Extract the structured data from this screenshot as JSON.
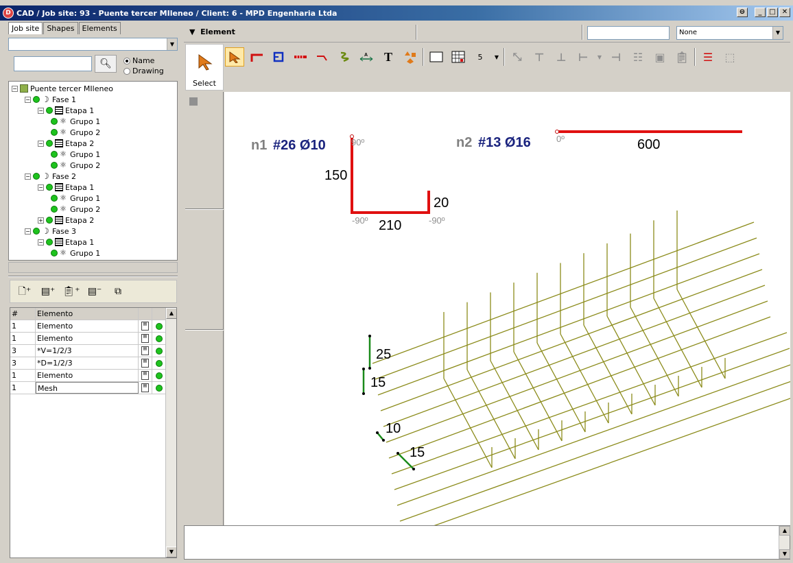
{
  "window": {
    "app_badge": "D",
    "title": "CAD / Job site: 93 - Puente tercer MIleneo  / Client: 6 - MPD Engenharia Ltda"
  },
  "left_panel": {
    "tabs": [
      "Job site",
      "Shapes",
      "Elements"
    ],
    "search": {
      "value": "",
      "radio_name": "Name",
      "radio_drawing": "Drawing"
    },
    "tree": [
      {
        "label": "Puente tercer MIleneo",
        "level": 0
      },
      {
        "label": "Fase 1",
        "level": 1
      },
      {
        "label": "Etapa 1",
        "level": 2
      },
      {
        "label": "Grupo 1",
        "level": 3
      },
      {
        "label": "Grupo 2",
        "level": 3
      },
      {
        "label": "Etapa 2",
        "level": 2
      },
      {
        "label": "Grupo 1",
        "level": 3
      },
      {
        "label": "Grupo 2",
        "level": 3
      },
      {
        "label": "Fase 2",
        "level": 1
      },
      {
        "label": "Etapa 1",
        "level": 2
      },
      {
        "label": "Grupo 1",
        "level": 3
      },
      {
        "label": "Grupo 2",
        "level": 3
      },
      {
        "label": "Etapa 2",
        "level": 2
      },
      {
        "label": "Fase 3",
        "level": 1
      },
      {
        "label": "Etapa 1",
        "level": 2
      },
      {
        "label": "Grupo 1",
        "level": 3
      }
    ],
    "grid": {
      "headers": [
        "#",
        "Elemento"
      ],
      "rows": [
        {
          "num": "1",
          "name": "Elemento"
        },
        {
          "num": "1",
          "name": "Elemento"
        },
        {
          "num": "3",
          "name": "*V=1/2/3"
        },
        {
          "num": "3",
          "name": "*D=1/2/3"
        },
        {
          "num": "1",
          "name": "Elemento"
        },
        {
          "num": "1",
          "name": "Mesh"
        }
      ]
    }
  },
  "element_bar": {
    "label": "Element",
    "search_value": "",
    "select_value": "None"
  },
  "select_tool": {
    "label": "Select"
  },
  "toolbar": {
    "number_value": "5"
  },
  "canvas": {
    "n1": {
      "prefix": "n1",
      "code": "#26 Ø10",
      "dims": [
        "150",
        "210",
        "20"
      ],
      "angles": [
        "90º",
        "-90º",
        "-90º"
      ]
    },
    "n2": {
      "prefix": "n2",
      "code": "#13 Ø16",
      "dims": [
        "600"
      ],
      "angles": [
        "0º"
      ]
    },
    "mesh_dims": [
      "25",
      "15",
      "10",
      "15"
    ]
  },
  "colors": {
    "bar_red": "#e01010",
    "mesh": "#8b8b1a",
    "label_grey": "#808080",
    "label_navy": "#1a237e",
    "marker_green": "#1a8a1a"
  }
}
